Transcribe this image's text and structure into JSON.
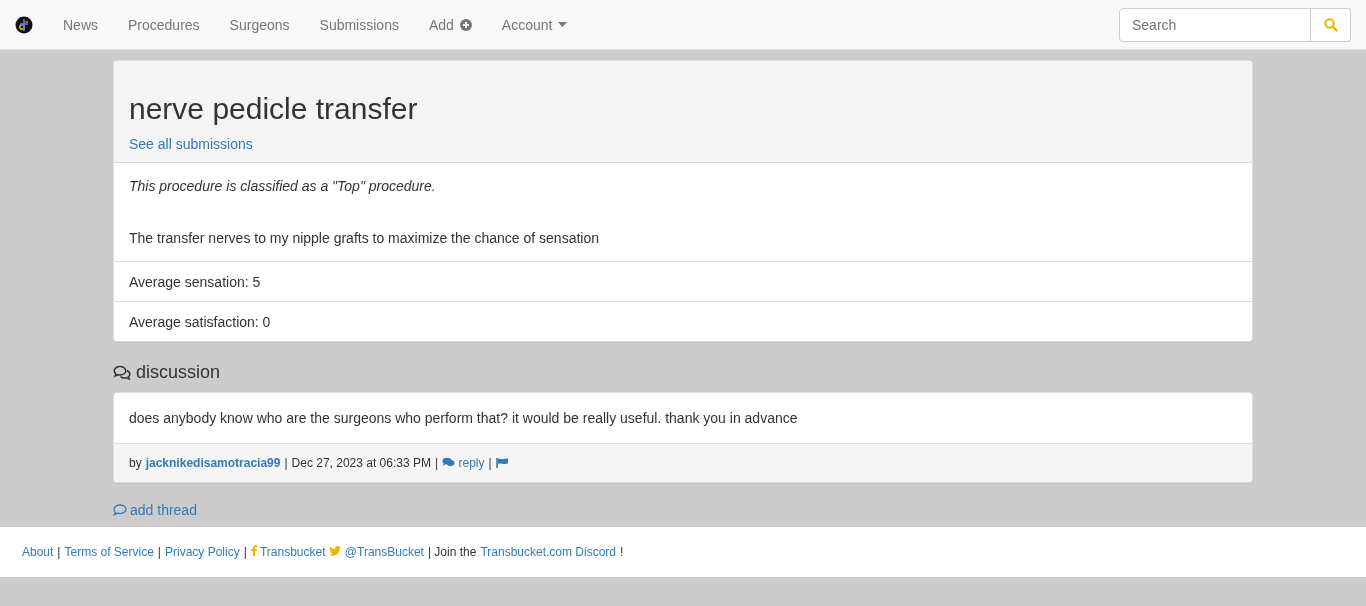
{
  "navbar": {
    "items": [
      {
        "label": "News",
        "kind": "plain"
      },
      {
        "label": "Procedures",
        "kind": "plain"
      },
      {
        "label": "Surgeons",
        "kind": "plain"
      },
      {
        "label": "Submissions",
        "kind": "plain"
      },
      {
        "label": "Add",
        "kind": "add"
      },
      {
        "label": "Account",
        "kind": "dropdown"
      }
    ],
    "search": {
      "placeholder": "Search"
    }
  },
  "procedure": {
    "title": "nerve pedicle transfer",
    "link": "See all submissions",
    "classification": "This procedure is classified as a \"Top\" procedure.",
    "description": "The transfer nerves to my nipple grafts to maximize the chance of sensation",
    "stats": [
      "Average sensation: 5",
      "Average satisfaction: 0"
    ]
  },
  "discussion": {
    "heading": "discussion",
    "threads": [
      {
        "body": "does anybody know who are the surgeons who perform that? it would be really useful. thank you in advance",
        "by": "by",
        "author": "jacknikedisamotracia99",
        "sep1": "|",
        "date": "Dec 27, 2023 at 06:33 PM",
        "sep2": "|",
        "reply": "reply",
        "sep3": "|"
      }
    ],
    "add_thread": "add thread"
  },
  "footer": {
    "parts": [
      {
        "kind": "link",
        "text": "About"
      },
      {
        "kind": "text",
        "text": "|"
      },
      {
        "kind": "link",
        "text": "Terms of Service"
      },
      {
        "kind": "text",
        "text": "|"
      },
      {
        "kind": "link",
        "text": "Privacy Policy"
      },
      {
        "kind": "text",
        "text": "|"
      },
      {
        "kind": "facebook",
        "text": "Transbucket"
      },
      {
        "kind": "twitter",
        "text": "@TransBucket"
      },
      {
        "kind": "text",
        "text": "| Join the"
      },
      {
        "kind": "link",
        "text": "Transbucket.com Discord"
      },
      {
        "kind": "text",
        "text": "!"
      }
    ]
  }
}
